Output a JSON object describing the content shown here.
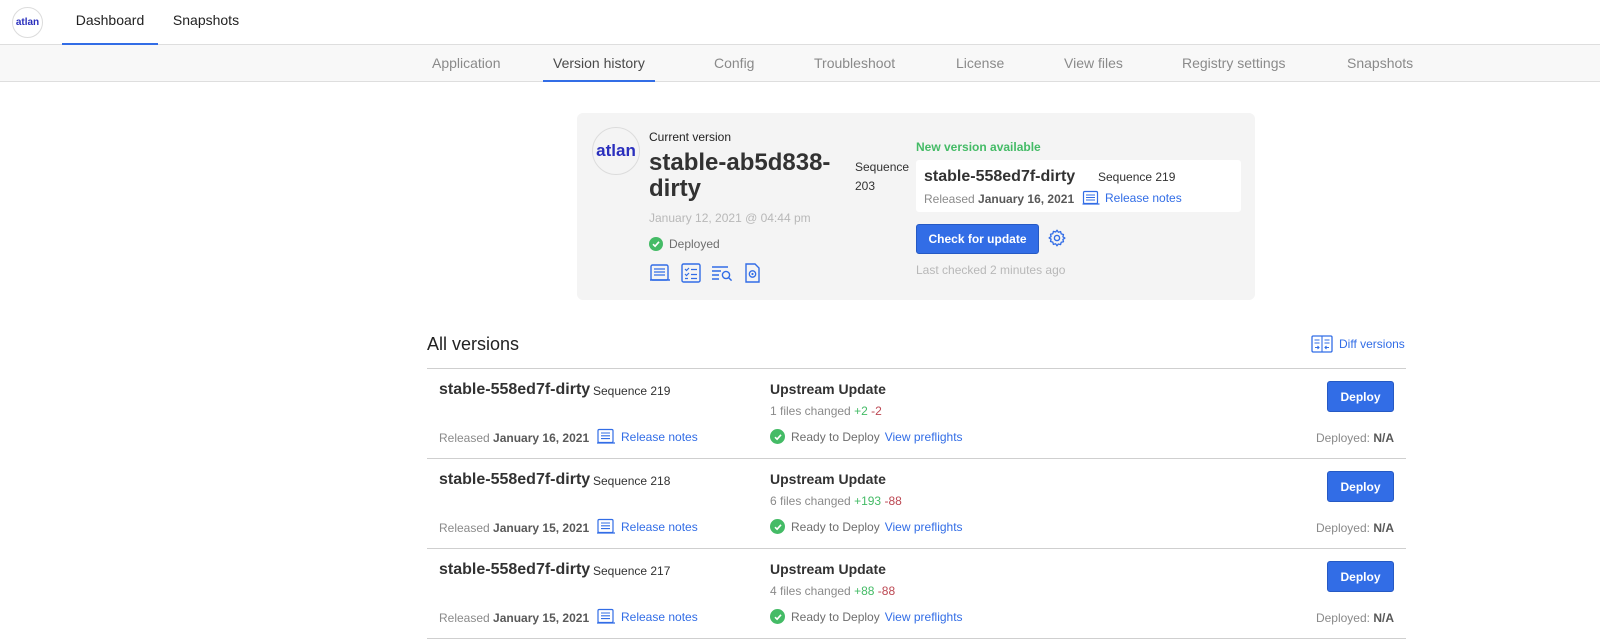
{
  "topnav": {
    "logo_text": "atlan",
    "tabs": [
      {
        "label": "Dashboard",
        "active": true
      },
      {
        "label": "Snapshots",
        "active": false
      }
    ]
  },
  "subnav": {
    "tabs": [
      {
        "label": "Application"
      },
      {
        "label": "Version history",
        "active": true
      },
      {
        "label": "Config"
      },
      {
        "label": "Troubleshoot"
      },
      {
        "label": "License"
      },
      {
        "label": "View files"
      },
      {
        "label": "Registry settings"
      },
      {
        "label": "Snapshots"
      }
    ]
  },
  "current": {
    "logo_text": "atlan",
    "label": "Current version",
    "title": "stable-ab5d838-dirty",
    "sequence": "Sequence 203",
    "date": "January 12, 2021 @ 04:44 pm",
    "status": "Deployed",
    "icons": [
      "release-notes-icon",
      "checklist-icon",
      "logs-search-icon",
      "config-file-icon"
    ]
  },
  "new_version": {
    "label": "New version available",
    "title": "stable-558ed7f-dirty",
    "sequence": "Sequence 219",
    "released_prefix": "Released",
    "released_date": "January 16, 2021",
    "release_notes": "Release notes",
    "check_button": "Check for update",
    "last_checked": "Last checked 2 minutes ago"
  },
  "all_versions": {
    "title": "All versions",
    "diff_label": "Diff versions",
    "rows": [
      {
        "title": "stable-558ed7f-dirty",
        "sequence": "Sequence 219",
        "released_prefix": "Released",
        "released_date": "January 16, 2021",
        "release_notes": "Release notes",
        "source": "Upstream Update",
        "files_changed": "1 files changed",
        "added": "+2",
        "removed": "-2",
        "ready": "Ready to Deploy",
        "preflights": "View preflights",
        "deploy": "Deploy",
        "deployed_label": "Deployed:",
        "deployed_value": "N/A"
      },
      {
        "title": "stable-558ed7f-dirty",
        "sequence": "Sequence 218",
        "released_prefix": "Released",
        "released_date": "January 15, 2021",
        "release_notes": "Release notes",
        "source": "Upstream Update",
        "files_changed": "6 files changed",
        "added": "+193",
        "removed": "-88",
        "ready": "Ready to Deploy",
        "preflights": "View preflights",
        "deploy": "Deploy",
        "deployed_label": "Deployed:",
        "deployed_value": "N/A"
      },
      {
        "title": "stable-558ed7f-dirty",
        "sequence": "Sequence 217",
        "released_prefix": "Released",
        "released_date": "January 15, 2021",
        "release_notes": "Release notes",
        "source": "Upstream Update",
        "files_changed": "4 files changed",
        "added": "+88",
        "removed": "-88",
        "ready": "Ready to Deploy",
        "preflights": "View preflights",
        "deploy": "Deploy",
        "deployed_label": "Deployed:",
        "deployed_value": "N/A"
      }
    ]
  },
  "colors": {
    "accent": "#326de6",
    "success": "#44bb66",
    "danger": "#bc4752",
    "card_bg": "#f4f4f4"
  }
}
